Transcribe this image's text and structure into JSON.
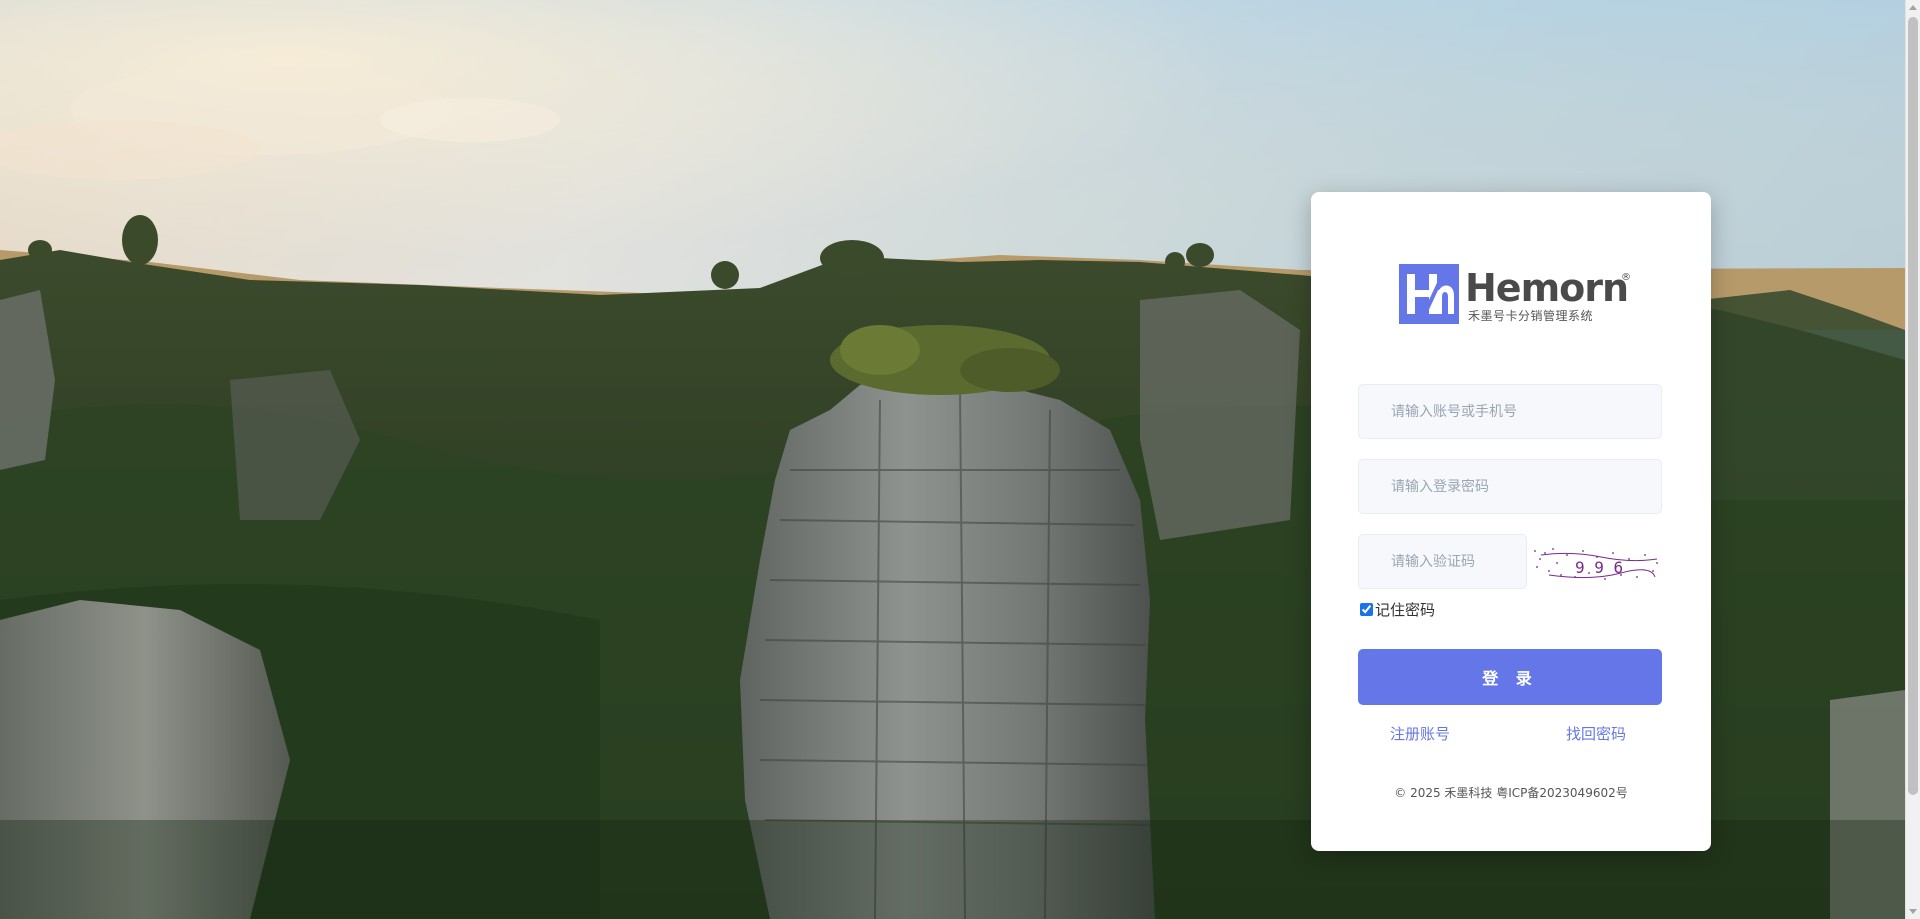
{
  "brand": {
    "name": "Hemorn",
    "registered_mark": "®",
    "subtitle": "禾墨号卡分销管理系统",
    "color": "#6577e8"
  },
  "form": {
    "account_placeholder": "请输入账号或手机号",
    "password_placeholder": "请输入登录密码",
    "captcha_placeholder": "请输入验证码",
    "captcha_text": "9 9 6",
    "remember_label": "记住密码",
    "remember_checked": true,
    "login_label": "登 录",
    "register_label": "注册账号",
    "recover_label": "找回密码"
  },
  "footer": {
    "text": "© 2025 禾墨科技 粤ICP备2023049602号"
  },
  "colors": {
    "primary": "#6577e8",
    "field_bg": "#f6f8fb",
    "placeholder": "#9aa5b4"
  }
}
